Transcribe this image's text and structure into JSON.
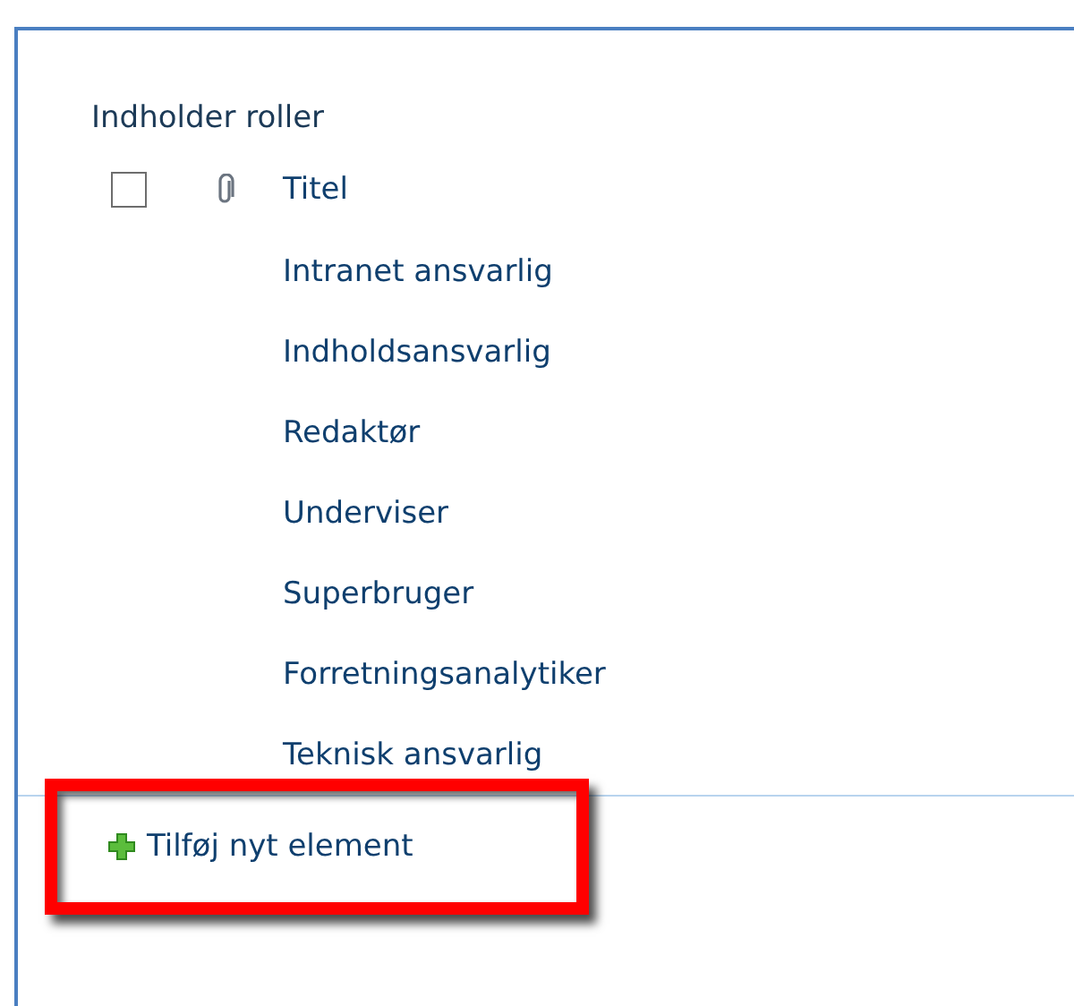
{
  "list_title": "Indholder roller",
  "header": {
    "checkbox": {
      "checked": false
    },
    "column": "Titel"
  },
  "rows": [
    "Intranet ansvarlig",
    "Indholdsansvarlig",
    "Redaktør",
    "Underviser",
    "Superbruger",
    "Forretningsanalytiker",
    "Teknisk ansvarlig"
  ],
  "add_link": "Tilføj nyt element"
}
